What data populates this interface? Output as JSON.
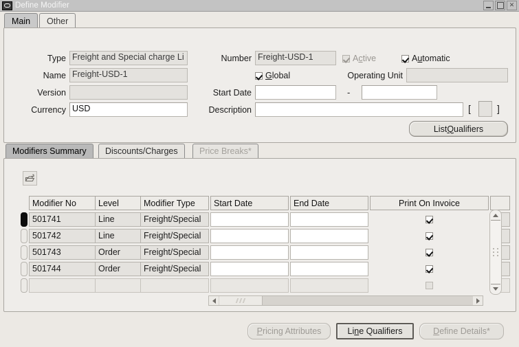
{
  "window": {
    "title": "Define Modifier",
    "icon": "oracle-logo-icon",
    "minimize_label": "Minimize",
    "maximize_label": "Maximize",
    "close_label": "✕"
  },
  "main_tabs": [
    {
      "label": "Main",
      "active": true
    },
    {
      "label": "Other",
      "active": false
    }
  ],
  "header_form": {
    "type": {
      "label": "Type",
      "value": "Freight and Special charge Li",
      "enabled": false
    },
    "name": {
      "label": "Name",
      "value": "Freight-USD-1",
      "enabled": false
    },
    "version": {
      "label": "Version",
      "value": "",
      "enabled": false
    },
    "currency": {
      "label": "Currency",
      "value": "USD",
      "enabled": true
    },
    "number": {
      "label": "Number",
      "value": "Freight-USD-1",
      "enabled": false
    },
    "active": {
      "label_pre": "A",
      "label_mn": "c",
      "label_post": "tive",
      "checked": true,
      "enabled": false
    },
    "automatic": {
      "label_pre": "A",
      "label_mn": "u",
      "label_post": "tomatic",
      "checked": true,
      "enabled": true
    },
    "global": {
      "label_pre": "",
      "label_mn": "G",
      "label_post": "lobal",
      "checked": true,
      "enabled": true
    },
    "operating_unit": {
      "label": "Operating Unit",
      "value": "",
      "enabled": false
    },
    "start_date": {
      "label": "Start Date",
      "value": "",
      "end_value": "",
      "separator": "-"
    },
    "description": {
      "label": "Description",
      "value": "",
      "flex_open": "[",
      "flex_close": "]",
      "flex_value": ""
    },
    "list_qualifiers": {
      "pre": "List ",
      "mn": "Q",
      "post": "ualifiers"
    }
  },
  "sub_tabs": [
    {
      "label": "Modifiers Summary",
      "state": "active"
    },
    {
      "label": "Discounts/Charges",
      "state": "normal"
    },
    {
      "label": "Price Breaks*",
      "state": "disabled"
    }
  ],
  "toolbar": {
    "folder_icon": "folder-open-icon"
  },
  "grid": {
    "columns": [
      "Modifier No",
      "Level",
      "Modifier Type",
      "Start Date",
      "End Date",
      "Print On Invoice"
    ],
    "rows": [
      {
        "modifier_no": "501741",
        "level": "Line",
        "modifier_type": "Freight/Special",
        "start_date": "",
        "end_date": "",
        "print_on_invoice": true,
        "current": true,
        "empty": false
      },
      {
        "modifier_no": "501742",
        "level": "Line",
        "modifier_type": "Freight/Special",
        "start_date": "",
        "end_date": "",
        "print_on_invoice": true,
        "current": false,
        "empty": false
      },
      {
        "modifier_no": "501743",
        "level": "Order",
        "modifier_type": "Freight/Special",
        "start_date": "",
        "end_date": "",
        "print_on_invoice": true,
        "current": false,
        "empty": false
      },
      {
        "modifier_no": "501744",
        "level": "Order",
        "modifier_type": "Freight/Special",
        "start_date": "",
        "end_date": "",
        "print_on_invoice": true,
        "current": false,
        "empty": false
      },
      {
        "modifier_no": "",
        "level": "",
        "modifier_type": "",
        "start_date": "",
        "end_date": "",
        "print_on_invoice": false,
        "current": false,
        "empty": true
      }
    ]
  },
  "footer_buttons": {
    "pricing_attributes": {
      "pre": "",
      "mn": "P",
      "post": "ricing Attributes",
      "enabled": false
    },
    "line_qualifiers": {
      "pre": "Li",
      "mn": "n",
      "post": "e Qualifiers",
      "enabled": true
    },
    "define_details": {
      "pre": "",
      "mn": "D",
      "post": "efine Details*",
      "enabled": false
    }
  },
  "colors": {
    "window_bg": "#ece9e4",
    "titlebar_bg": "#c3c3c3",
    "field_disabled": "#e4e2de",
    "field_enabled": "#ffffff",
    "tab_active": "#b9b9b9"
  }
}
